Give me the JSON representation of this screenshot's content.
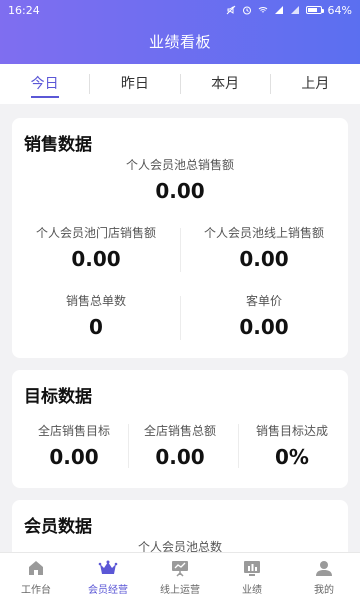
{
  "status_bar": {
    "time": "16:24",
    "battery": "64%"
  },
  "header": {
    "title": "业绩看板"
  },
  "tabs": [
    {
      "label": "今日",
      "active": true
    },
    {
      "label": "昨日",
      "active": false
    },
    {
      "label": "本月",
      "active": false
    },
    {
      "label": "上月",
      "active": false
    }
  ],
  "sales": {
    "title": "销售数据",
    "total_label": "个人会员池总销售额",
    "total_value": "0.00",
    "store_label": "个人会员池门店销售额",
    "store_value": "0.00",
    "online_label": "个人会员池线上销售额",
    "online_value": "0.00",
    "orders_label": "销售总单数",
    "orders_value": "0",
    "avg_label": "客单价",
    "avg_value": "0.00"
  },
  "targets": {
    "title": "目标数据",
    "goal_label": "全店销售目标",
    "goal_value": "0.00",
    "total_label": "全店销售总额",
    "total_value": "0.00",
    "rate_label": "销售目标达成",
    "rate_value": "0%"
  },
  "members": {
    "title": "会员数据",
    "pool_label": "个人会员池总数"
  },
  "bottom_nav": [
    {
      "label": "工作台",
      "icon": "home-icon",
      "active": false
    },
    {
      "label": "会员经营",
      "icon": "crown-icon",
      "active": true
    },
    {
      "label": "线上运营",
      "icon": "presentation-icon",
      "active": false
    },
    {
      "label": "业绩",
      "icon": "chart-icon",
      "active": false
    },
    {
      "label": "我的",
      "icon": "user-icon",
      "active": false
    }
  ],
  "colors": {
    "accent": "#5b57d6",
    "header_start": "#7f6ef0",
    "header_end": "#5b6ff0"
  }
}
